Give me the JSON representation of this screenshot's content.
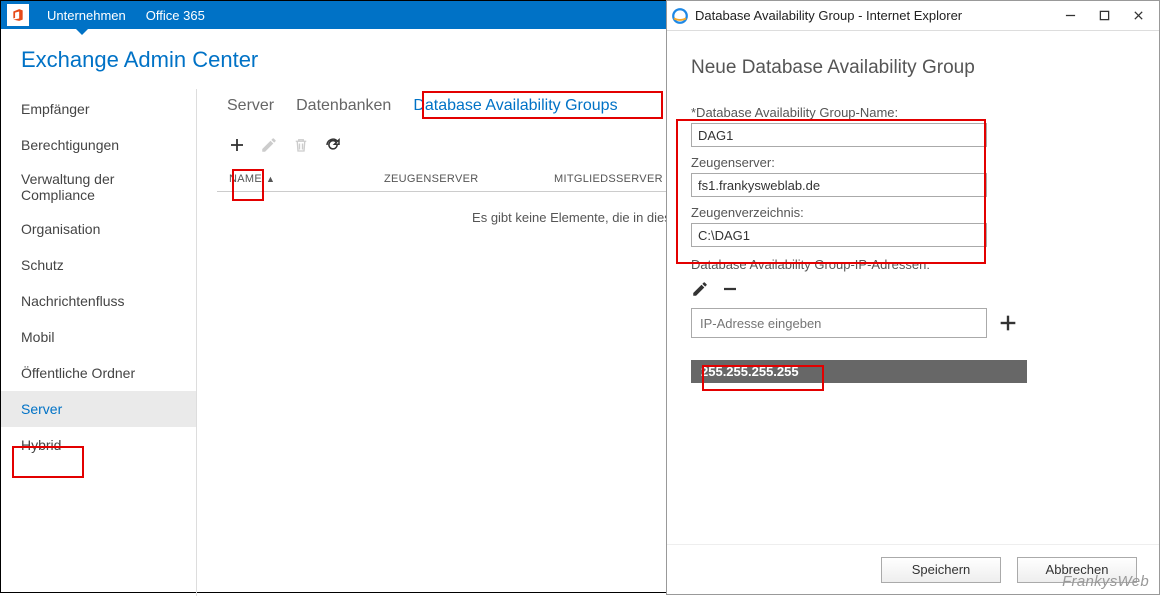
{
  "topbar": {
    "company": "Unternehmen",
    "office": "Office 365"
  },
  "brand": "Exchange Admin Center",
  "sidebar": {
    "items": [
      "Empfänger",
      "Berechtigungen",
      "Verwaltung der Compliance",
      "Organisation",
      "Schutz",
      "Nachrichtenfluss",
      "Mobil",
      "Öffentliche Ordner",
      "Server",
      "Hybrid"
    ],
    "active_index": 8
  },
  "tabs": {
    "items": [
      "Server",
      "Datenbanken",
      "Database Availability Groups"
    ],
    "active_index": 2
  },
  "table": {
    "headers": {
      "name": "NAME",
      "witness": "ZEUGENSERVER",
      "members": "MITGLIEDSSERVER"
    },
    "empty": "Es gibt keine Elemente, die in dieser Ansicht angezeigt werden können."
  },
  "popup": {
    "window_title": "Database Availability Group - Internet Explorer",
    "heading": "Neue Database Availability Group",
    "name_label": "*Database Availability Group-Name:",
    "name_value": "DAG1",
    "witness_label": "Zeugenserver:",
    "witness_value": "fs1.frankysweblab.de",
    "witnessdir_label": "Zeugenverzeichnis:",
    "witnessdir_value": "C:\\DAG1",
    "ip_section_label": "Database Availability Group-IP-Adressen:",
    "ip_placeholder": "IP-Adresse eingeben",
    "ip_list": [
      "255.255.255.255"
    ],
    "save": "Speichern",
    "cancel": "Abbrechen"
  },
  "watermark": "FrankysWeb"
}
